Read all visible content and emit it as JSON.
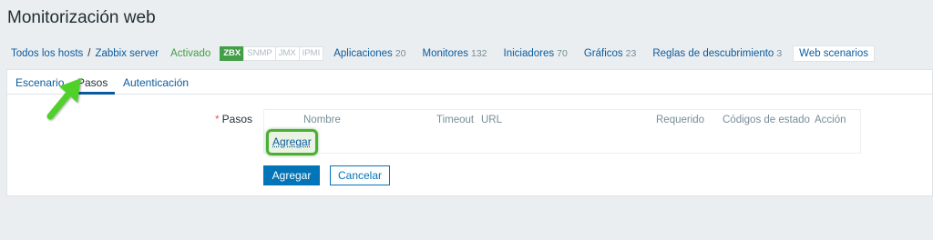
{
  "page": {
    "title": "Monitorización web"
  },
  "breadcrumb": {
    "all_hosts": "Todos los hosts",
    "separator": "/",
    "host": "Zabbix server",
    "status": "Activado",
    "availability": [
      "ZBX",
      "SNMP",
      "JMX",
      "IPMI"
    ]
  },
  "host_nav": [
    {
      "label": "Aplicaciones",
      "count": "20"
    },
    {
      "label": "Monitores",
      "count": "132"
    },
    {
      "label": "Iniciadores",
      "count": "70"
    },
    {
      "label": "Gráficos",
      "count": "23"
    },
    {
      "label": "Reglas de descubrimiento",
      "count": "3"
    },
    {
      "label": "Web scenarios"
    }
  ],
  "tabs": [
    "Escenario",
    "Pasos",
    "Autenticación"
  ],
  "form": {
    "required_mark": "*",
    "steps_label": "Pasos",
    "columns": [
      "Nombre",
      "Timeout",
      "URL",
      "Requerido",
      "Códigos de estado",
      "Acción"
    ],
    "add_step_link": "Agregar"
  },
  "buttons": {
    "submit": "Agregar",
    "cancel": "Cancelar"
  },
  "colors": {
    "accent": "#0275b8",
    "link": "#0a5b9e",
    "enabled_green": "#429e47",
    "highlight_green": "#4caf35"
  }
}
